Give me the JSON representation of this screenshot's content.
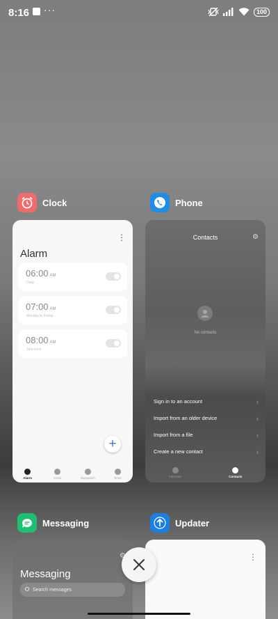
{
  "status_bar": {
    "time": "8:16",
    "more": "···",
    "battery": "100"
  },
  "apps": {
    "clock": {
      "name": "Clock",
      "color": "#f06b6b",
      "screen_title": "Alarm",
      "alarms": [
        {
          "time": "06:00",
          "ampm": "AM",
          "sub": "Daily"
        },
        {
          "time": "07:00",
          "ampm": "AM",
          "sub": "Monday to Friday"
        },
        {
          "time": "08:00",
          "ampm": "AM",
          "sub": "Just once"
        }
      ],
      "fab": "+",
      "nav": [
        "Alarm",
        "Clock",
        "Stopwatch",
        "Timer"
      ]
    },
    "phone": {
      "name": "Phone",
      "color": "#1f8de6",
      "screen_title": "Contacts",
      "empty_text": "No contacts",
      "options": [
        "Sign in to an account",
        "Import from an older device",
        "Import from a file",
        "Create a new contact"
      ],
      "nav": [
        "Favorites",
        "Contacts"
      ]
    },
    "messaging": {
      "name": "Messaging",
      "color": "#1fbf73",
      "screen_title": "Messaging",
      "search_placeholder": "Search messages"
    },
    "updater": {
      "name": "Updater",
      "color": "#1a7fe0"
    }
  }
}
